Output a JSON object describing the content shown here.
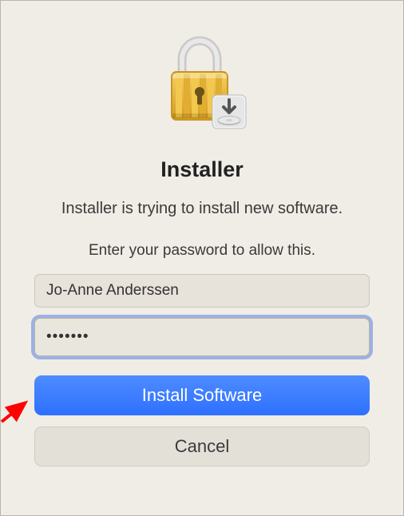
{
  "dialog": {
    "title": "Installer",
    "message": "Installer is trying to install new software.",
    "submessage": "Enter your password to allow this.",
    "username_value": "Jo-Anne Anderssen",
    "password_value": "•••••••",
    "primary_label": "Install Software",
    "cancel_label": "Cancel"
  },
  "icons": {
    "lock": "lock-icon",
    "installer_badge": "installer-badge-icon"
  },
  "annotation": {
    "arrow_color": "#ff0000"
  }
}
